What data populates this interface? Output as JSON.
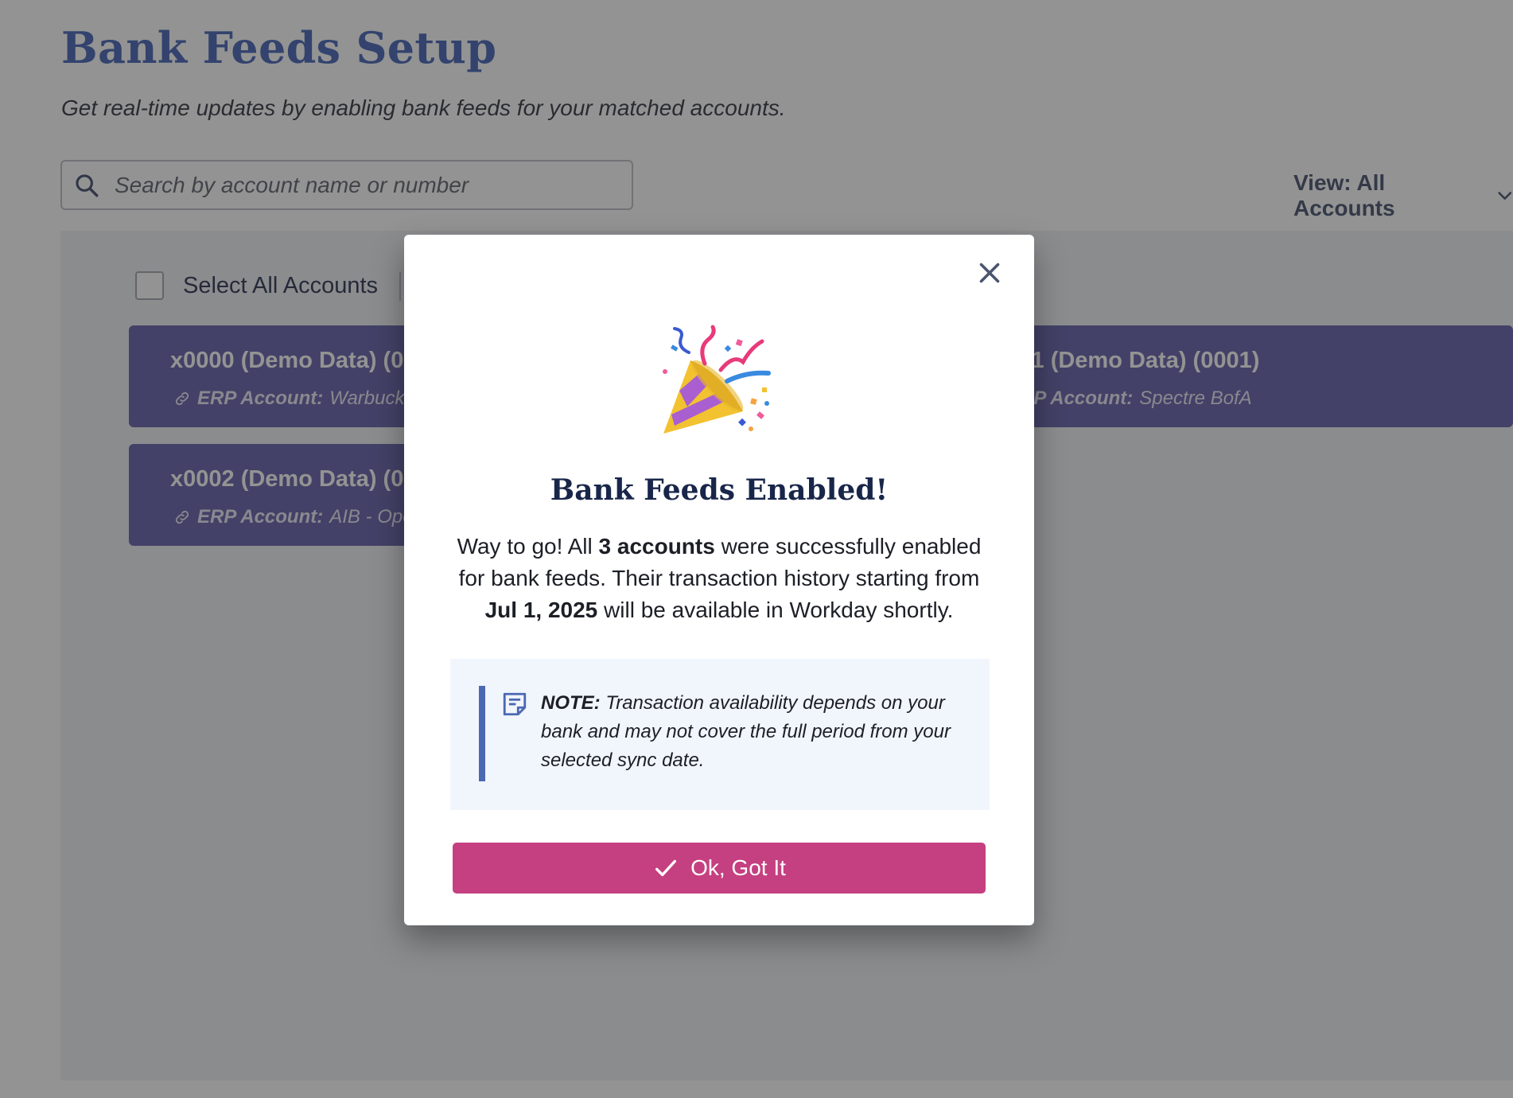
{
  "page": {
    "title": "Bank Feeds Setup",
    "subtitle": "Get real-time updates by enabling bank feeds for your matched accounts.",
    "search": {
      "placeholder": "Search by account name or number",
      "value": ""
    },
    "view_dropdown": "View: All Accounts",
    "select_all_label": "Select All Accounts"
  },
  "accounts": [
    {
      "name": "x0000 (Demo Data) (0000)",
      "erp_label": "ERP Account:",
      "erp_value": "Warbucks Bank"
    },
    {
      "name": "x0001 (Demo Data) (0001)",
      "erp_label": "ERP Account:",
      "erp_value": "Spectre BofA"
    },
    {
      "name": "x0002 (Demo Data) (0002)",
      "erp_label": "ERP Account:",
      "erp_value": "AIB - Operating"
    }
  ],
  "modal": {
    "title": "Bank Feeds Enabled!",
    "body_part1": "Way to go! All ",
    "body_bold_count": "3 accounts",
    "body_part2": " were successfully enabled for bank feeds. Their transaction history starting from ",
    "body_bold_date": "Jul 1, 2025",
    "body_part3": " will be available in Workday shortly.",
    "note_label": "NOTE:",
    "note_text": " Transaction availability depends on your bank and may not cover the full period from your selected sync date.",
    "ok_button": "Ok, Got It"
  },
  "colors": {
    "title_blue": "#3f5fb5",
    "card_purple": "#5e5aa6",
    "button_pink": "#c54080",
    "note_bg": "#f1f5fc",
    "note_bar": "#4b68b3"
  },
  "icons": [
    "search-icon",
    "chevron-down-icon",
    "link-icon",
    "close-icon",
    "party-popper-icon",
    "note-icon",
    "check-icon"
  ]
}
